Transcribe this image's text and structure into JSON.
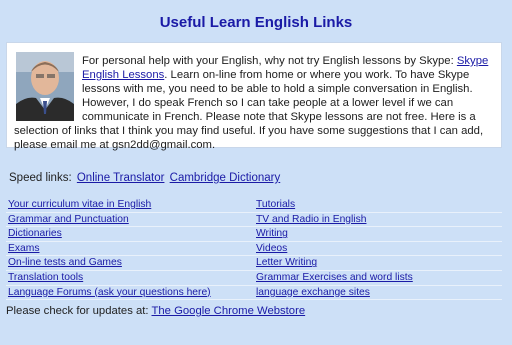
{
  "page": {
    "title": "Useful Learn English Links"
  },
  "intro": {
    "text_before_link": "For personal help with your English, why not try English lessons by Skype: ",
    "skype_link": "Skype English Lessons",
    "text_after_link": ". Learn on-line from home or where you work. To have Skype lessons with me, you need to be able to hold a simple conversation in English. However, I do speak French so I can take people at a lower level if we can communicate in French. Please note that Skype lessons are not free. Here is a selection of links that I think you may find useful. If you have some suggestions that I can add, please email me at gsn2dd@gmail.com."
  },
  "speed_links": {
    "label": "Speed links:",
    "link1": "Online Translator",
    "link2": "Cambridge Dictionary"
  },
  "links_table": {
    "rows": [
      {
        "left": "Your curriculum vitae in English",
        "right": "Tutorials"
      },
      {
        "left": "Grammar and Punctuation",
        "right": "TV and Radio in English"
      },
      {
        "left": "Dictionaries",
        "right": "Writing"
      },
      {
        "left": "Exams",
        "right": "Videos"
      },
      {
        "left": "On-line tests and Games",
        "right": "Letter Writing"
      },
      {
        "left": "Translation tools",
        "right": "Grammar Exercises and word lists"
      },
      {
        "left": "Language Forums (ask your questions here)",
        "right": "language exchange sites"
      }
    ]
  },
  "updates": {
    "label": "Please check for updates at: ",
    "link": "The Google Chrome Webstore"
  },
  "colors": {
    "background": "#cde0f7",
    "link": "#1a1aa6",
    "title": "#1a1aa6"
  }
}
